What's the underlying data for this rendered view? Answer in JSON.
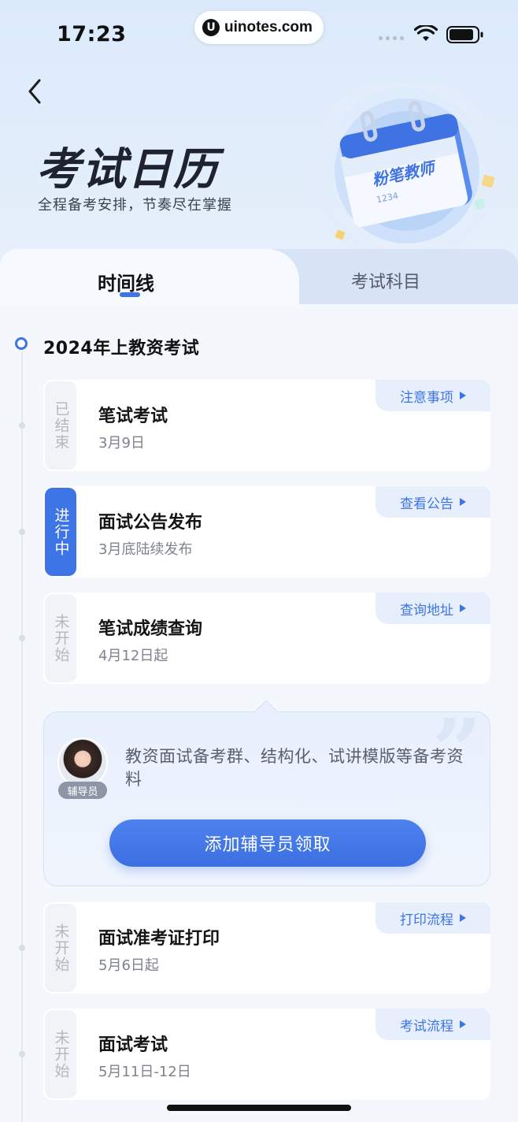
{
  "status_bar": {
    "time": "17:23",
    "url_logo": "U",
    "url": "uinotes.com"
  },
  "header": {
    "title": "考试日历",
    "subtitle": "全程备考安排，节奏尽在掌握",
    "hero_calendar_text": "粉笔教师",
    "hero_calendar_number": "1234"
  },
  "tabs": [
    {
      "label": "时间线",
      "active": true
    },
    {
      "label": "考试科目",
      "active": false
    }
  ],
  "section": {
    "title": "2024年上教资考试"
  },
  "events": [
    {
      "status": "已结束",
      "title": "笔试考试",
      "date": "3月9日",
      "link": "注意事项",
      "active": false
    },
    {
      "status": "进行中",
      "title": "面试公告发布",
      "date": "3月底陆续发布",
      "link": "查看公告",
      "active": true
    },
    {
      "status": "未开始",
      "title": "笔试成绩查询",
      "date": "4月12日起",
      "link": "查询地址",
      "active": false
    },
    {
      "status": "未开始",
      "title": "面试准考证打印",
      "date": "5月6日起",
      "link": "打印流程",
      "active": false
    },
    {
      "status": "未开始",
      "title": "面试考试",
      "date": "5月11日-12日",
      "link": "考试流程",
      "active": false
    }
  ],
  "promo": {
    "badge": "辅导员",
    "text": "教资面试备考群、结构化、试讲模版等备考资料",
    "button": "添加辅导员领取",
    "quote_mark": "”"
  },
  "colors": {
    "accent": "#3d74e6",
    "link_bg": "#e7effc",
    "inactive_status": "#b3b7c0"
  }
}
